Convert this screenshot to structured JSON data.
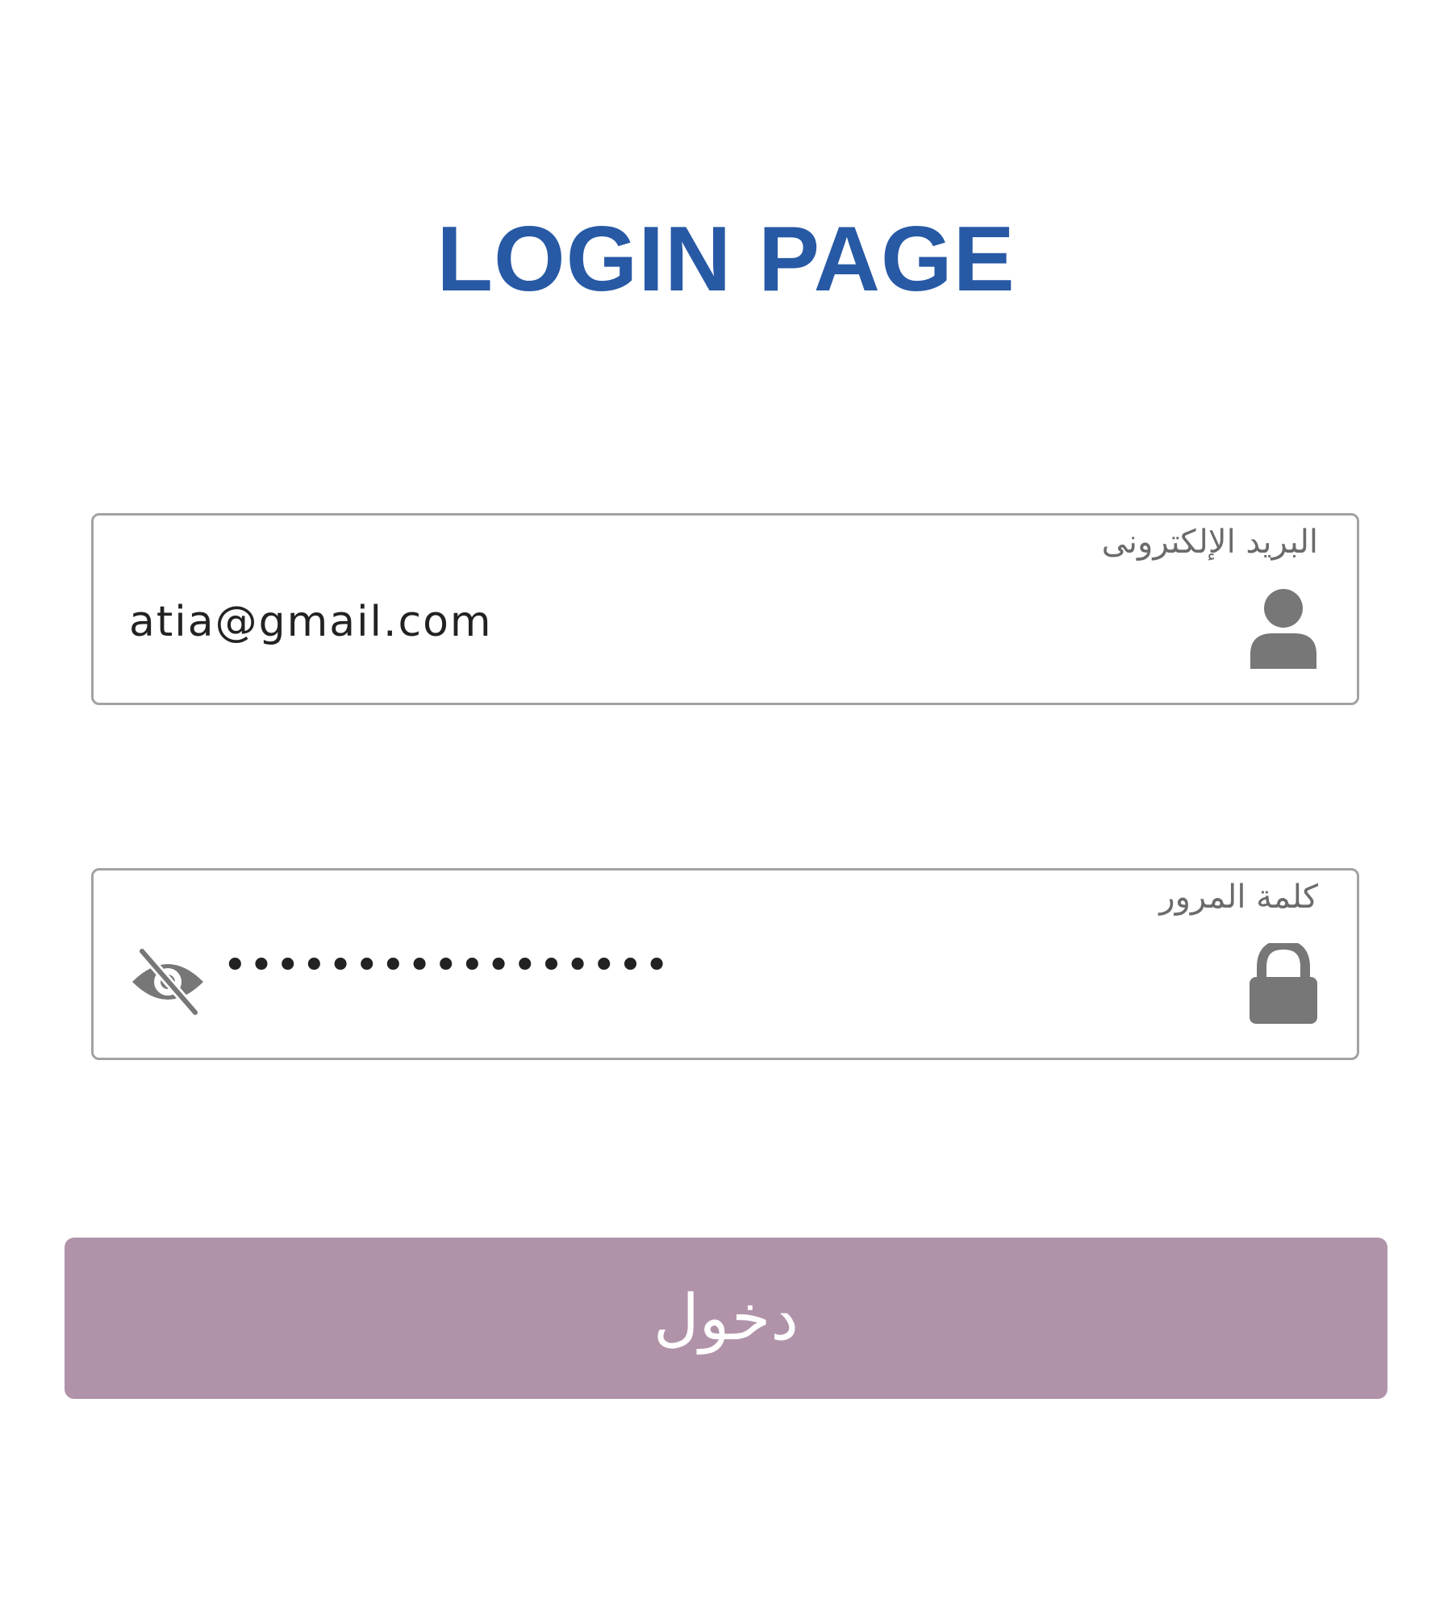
{
  "page": {
    "title": "LOGIN PAGE"
  },
  "email_field": {
    "label": "البريد الإلكترونى",
    "value": "atia@gmail.com",
    "icon": "user-icon"
  },
  "password_field": {
    "label": "كلمة المرور",
    "value": "•••••••••••••••••",
    "icon": "lock-icon",
    "toggle_icon": "eye-slash-icon"
  },
  "login_button": {
    "label": "دخول"
  },
  "colors": {
    "title": "#2759a5",
    "button_background": "#b193a9",
    "icon": "#777777",
    "border": "#a2a2a2"
  }
}
